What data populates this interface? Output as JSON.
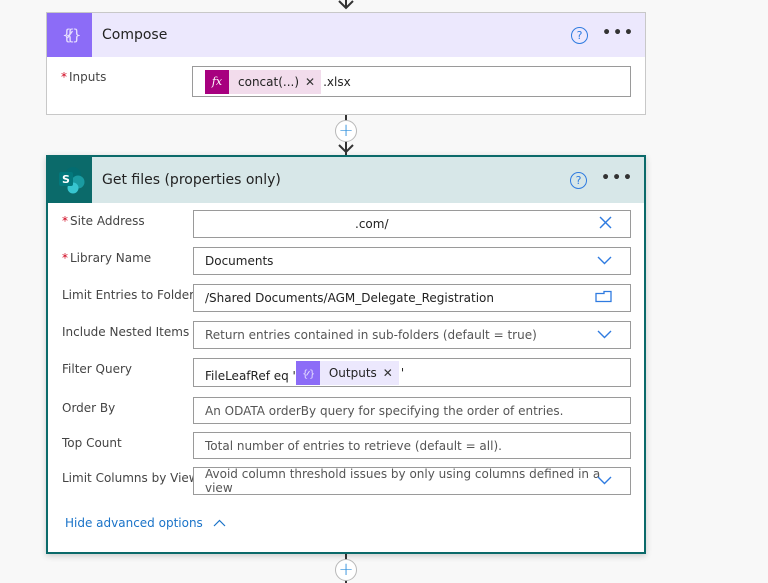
{
  "compose": {
    "title": "Compose",
    "icon": "compose-braces-icon",
    "accent": "#8c6cf7",
    "header_bg": "#ece8fd",
    "help_label": "?",
    "more_label": "•••",
    "fields": [
      {
        "label": "Inputs",
        "required": true,
        "token": {
          "type": "expression",
          "icon_label": "fx",
          "label": "concat(...)",
          "color": "#a7007f"
        },
        "suffix": ".xlsx"
      }
    ]
  },
  "get_files": {
    "title": "Get files (properties only)",
    "icon": "sharepoint-icon",
    "accent": "#0b6a6a",
    "header_bg": "#d7e7e8",
    "help_label": "?",
    "more_label": "•••",
    "fields": [
      {
        "label": "Site Address",
        "required": true,
        "value": ".com/",
        "placeholder": "",
        "trailing_icon": "clear-icon"
      },
      {
        "label": "Library Name",
        "required": true,
        "value": "Documents",
        "trailing_icon": "chevron-down-icon"
      },
      {
        "label": "Limit Entries to Folder",
        "required": false,
        "value": "/Shared Documents/AGM_Delegate_Registration",
        "trailing_icon": "folder-icon"
      },
      {
        "label": "Include Nested Items",
        "required": false,
        "placeholder": "Return entries contained in sub-folders (default = true)",
        "trailing_icon": "chevron-down-icon"
      },
      {
        "label": "Filter Query",
        "required": false,
        "prefix": "FileLeafRef eq '",
        "token": {
          "type": "output",
          "label": "Outputs",
          "color": "#8c6cf7"
        },
        "suffix": "'"
      },
      {
        "label": "Order By",
        "required": false,
        "placeholder": "An ODATA orderBy query for specifying the order of entries."
      },
      {
        "label": "Top Count",
        "required": false,
        "placeholder": "Total number of entries to retrieve (default = all)."
      },
      {
        "label": "Limit Columns by View",
        "required": false,
        "placeholder": "Avoid column threshold issues by only using columns defined in a view",
        "trailing_icon": "chevron-down-icon"
      }
    ],
    "advanced_toggle": "Hide advanced options"
  },
  "connector": {
    "add_label": "+"
  }
}
